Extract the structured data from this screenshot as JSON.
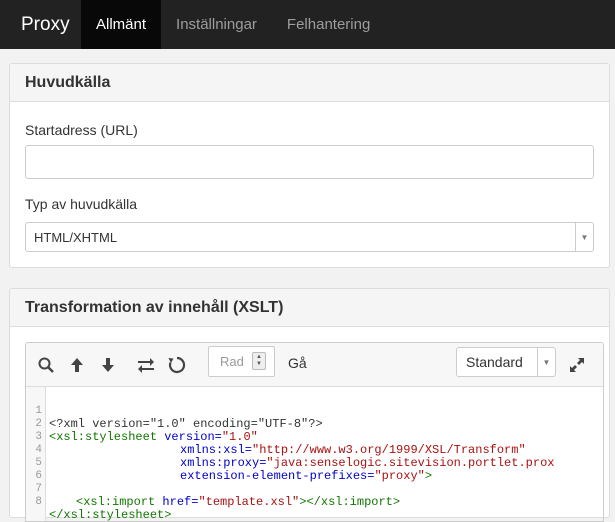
{
  "nav": {
    "brand": "Proxy",
    "tabs": [
      "Allmänt",
      "Inställningar",
      "Felhantering"
    ]
  },
  "main_source": {
    "title": "Huvudkälla",
    "url_label": "Startadress (URL)",
    "url_value": "",
    "type_label": "Typ av huvudkälla",
    "type_value": "HTML/XHTML"
  },
  "xslt": {
    "title": "Transformation av innehåll (XSLT)",
    "toolbar": {
      "line_placeholder": "Rad",
      "go_label": "Gå",
      "theme_value": "Standard"
    },
    "line_numbers": [
      "1",
      "2",
      "3",
      "4",
      "5",
      "6",
      "7",
      "8"
    ],
    "code": {
      "l1": "<?xml version=\"1.0\" encoding=\"UTF-8\"?>",
      "l2_tag": "<xsl:stylesheet",
      "l2_attr": " version=",
      "l2_str": "\"1.0\"",
      "l3_attr": "xmlns:xsl=",
      "l3_str": "\"http://www.w3.org/1999/XSL/Transform\"",
      "l4_attr": "xmlns:proxy=",
      "l4_str": "\"java:senselogic.sitevision.portlet.prox",
      "l5_attr": "extension-element-prefixes=",
      "l5_str": "\"proxy\"",
      "l5_tag": ">",
      "l7_tag": "<xsl:import",
      "l7_attr": " href=",
      "l7_str": "\"template.xsl\"",
      "l7_tag2": "></xsl:import>",
      "l8_tag": "</xsl:stylesheet>"
    }
  }
}
